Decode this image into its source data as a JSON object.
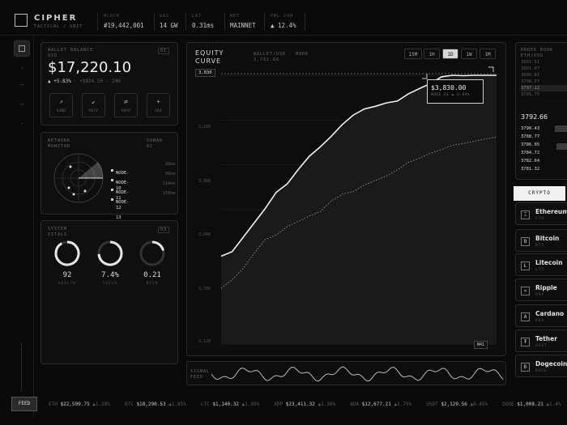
{
  "header": {
    "title": "CIPHER",
    "subtitle": "TACTICAL / UNIT",
    "stats": [
      {
        "key": "BLOCK",
        "value": "#19,442,001"
      },
      {
        "key": "GAS",
        "value": "14 GW"
      },
      {
        "key": "LAT",
        "value": "0.31ms"
      },
      {
        "key": "NET",
        "value": "MAINNET"
      },
      {
        "key": "PNL 24H",
        "value": "▲ 12.4%"
      }
    ]
  },
  "wallet": {
    "label": "WALLET BALANCE",
    "sublabel": "USD",
    "tag": "01",
    "balance": "$17,220.10",
    "change_pct": "▲ +5.83%",
    "change_abs": "· +$824.50 · 24H",
    "actions": [
      {
        "icon": "↗",
        "label": "SEND"
      },
      {
        "icon": "↙",
        "label": "RECV"
      },
      {
        "icon": "⇄",
        "label": "SWAP"
      },
      {
        "icon": "+",
        "label": "ADD"
      }
    ]
  },
  "network": {
    "title_1": "NETWORK",
    "title_2": "MONITOR",
    "meta_1": "SONAR-",
    "meta_2": "02",
    "nodes": [
      {
        "name_1": "NODE-",
        "name_2": "10",
        "ms": "28ms"
      },
      {
        "name_1": "NODE-",
        "name_2": "11",
        "ms": "99ms"
      },
      {
        "name_1": "NODE-",
        "name_2": "12",
        "ms": "114ms"
      },
      {
        "name_1": "NODE-",
        "name_2": "13",
        "ms": "158ms"
      }
    ]
  },
  "vitals": {
    "title_1": "SYSTEM",
    "title_2": "VITALS",
    "tag": "03",
    "gauges": [
      {
        "value": "92",
        "label": "HEALTH",
        "fraction": 0.92
      },
      {
        "value": "7.4%",
        "label": "YIELD",
        "fraction": 0.74
      },
      {
        "value": "0.21",
        "label": "RISK",
        "fraction": 0.21
      }
    ]
  },
  "chart_panel": {
    "title_1": "EQUITY",
    "title_2": "CURVE",
    "meta_1": "WALLET/USD · MARK",
    "meta_2": "3,792.66",
    "timeframes": [
      "15M",
      "1H",
      "1D",
      "1W",
      "1M"
    ],
    "active_timeframe": "1D",
    "tooltip_value": "$3,830.00",
    "tooltip_sub": "NODE 01 ▲ 6.99%",
    "top_label": "3,830",
    "bottom_label": "N41",
    "strip_label_1": "SIGNAL",
    "strip_label_2": "FEED"
  },
  "chart_data": {
    "type": "line",
    "yticks": [
      "3,160",
      "3,980",
      "3,840",
      "3,700",
      "3,120"
    ],
    "ylim": [
      3120,
      3830
    ],
    "series": [
      {
        "style": "solid",
        "values": [
          3352,
          3364,
          3402,
          3440,
          3478,
          3521,
          3543,
          3581,
          3616,
          3641,
          3669,
          3700,
          3725,
          3741,
          3748,
          3757,
          3762,
          3781,
          3795,
          3808,
          3826,
          3830,
          3829,
          3830,
          3830,
          3830
        ]
      },
      {
        "style": "dotted",
        "values": [
          3268,
          3290,
          3320,
          3360,
          3396,
          3408,
          3430,
          3444,
          3458,
          3470,
          3498,
          3516,
          3523,
          3540,
          3552,
          3564,
          3580,
          3600,
          3611,
          3624,
          3634,
          3645,
          3650,
          3656,
          3662,
          3667
        ]
      }
    ]
  },
  "orderbook": {
    "title_1": "ORDER BOOK",
    "title_2": "ETH/USD",
    "asks": [
      "3801.51",
      "3801.07",
      "3800.81",
      "3798.57",
      "3797.12",
      "3795.75"
    ],
    "mid": "3792.66",
    "bids": [
      "3790.43",
      "3788.77",
      "3786.95",
      "3784.72",
      "3782.64",
      "3781.32"
    ]
  },
  "tabs": {
    "crypto": "CRYPTO"
  },
  "coins": [
    {
      "icon": "Ξ",
      "name": "Ethereum",
      "ticker": "ETH"
    },
    {
      "icon": "B",
      "name": "Bitcoin",
      "ticker": "BTC"
    },
    {
      "icon": "Ł",
      "name": "Litecoin",
      "ticker": "LTC"
    },
    {
      "icon": "×",
      "name": "Ripple",
      "ticker": "XRP"
    },
    {
      "icon": "A",
      "name": "Cardano",
      "ticker": "ADA"
    },
    {
      "icon": "₮",
      "name": "Tether",
      "ticker": "USDT"
    },
    {
      "icon": "Ð",
      "name": "Dogecoin",
      "ticker": "DOGE"
    }
  ],
  "ticker": {
    "button": "FEED",
    "items": [
      {
        "sym": "ETH",
        "price": "$22,599.75",
        "chg": "▲1.28%"
      },
      {
        "sym": "BTC",
        "price": "$18,290.53",
        "chg": "▲1.85%"
      },
      {
        "sym": "LTC",
        "price": "$1,140.32",
        "chg": "▲1.85%"
      },
      {
        "sym": "XRP",
        "price": "$23,411.32",
        "chg": "▲1.36%"
      },
      {
        "sym": "ADA",
        "price": "$12,677.21",
        "chg": "▲1.75%"
      },
      {
        "sym": "USDT",
        "price": "$2,129.56",
        "chg": "▲0.45%"
      },
      {
        "sym": "DOGE",
        "price": "$1,008.21",
        "chg": "▲1.4%"
      }
    ]
  }
}
